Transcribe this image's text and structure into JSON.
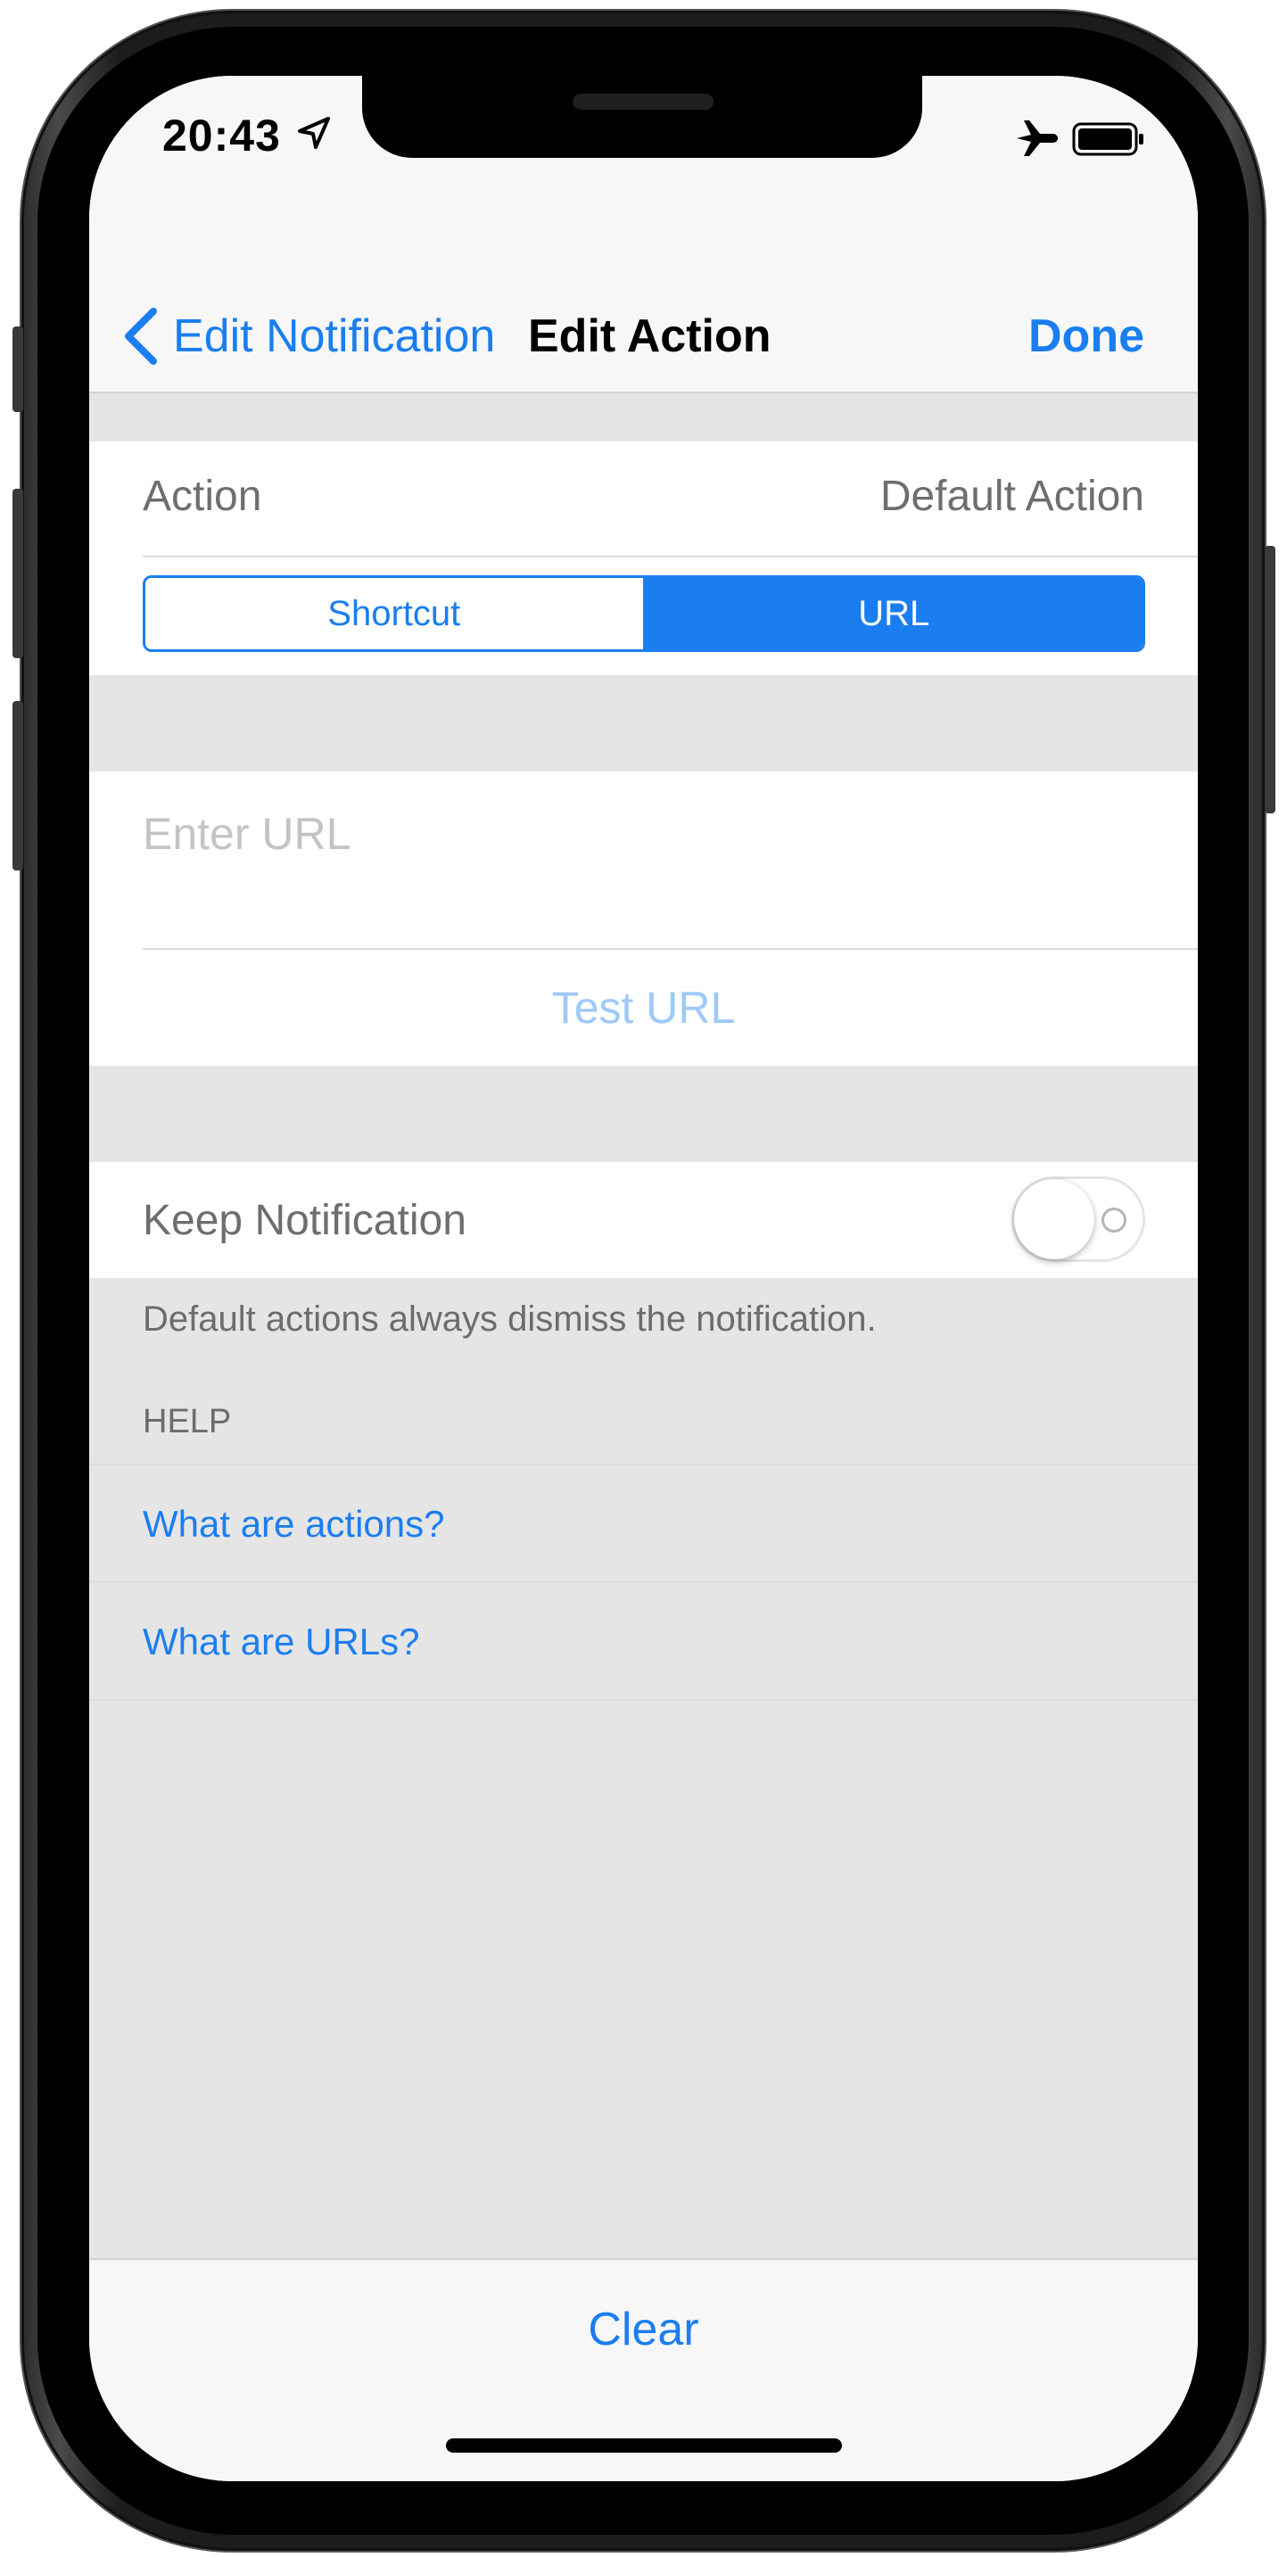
{
  "status_bar": {
    "time": "20:43",
    "location_icon": "location-arrow-icon",
    "airplane_icon": "airplane-icon",
    "battery_icon": "battery-icon"
  },
  "nav": {
    "back_label": "Edit Notification",
    "title": "Edit Action",
    "done_label": "Done"
  },
  "action_section": {
    "label": "Action",
    "value": "Default Action",
    "segments": [
      "Shortcut",
      "URL"
    ],
    "selected_segment": "URL"
  },
  "url_section": {
    "placeholder": "Enter URL",
    "value": "",
    "test_label": "Test URL"
  },
  "keep_section": {
    "label": "Keep Notification",
    "toggle_on": false,
    "footer": "Default actions always dismiss the notification."
  },
  "help_section": {
    "header": "HELP",
    "links": [
      "What are actions?",
      "What are URLs?"
    ]
  },
  "bottom": {
    "clear_label": "Clear"
  },
  "colors": {
    "accent": "#1a7ef0",
    "background": "#e5e5e5",
    "disabled_link": "#9fc9f7"
  }
}
